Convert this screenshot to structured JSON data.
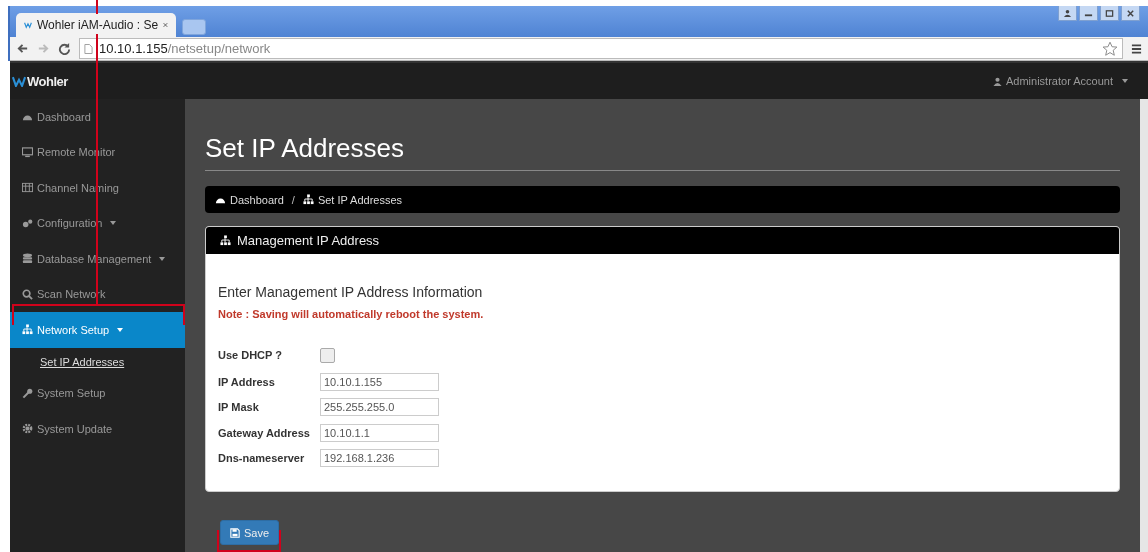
{
  "browser": {
    "tab_title": "Wohler iAM-Audio : Se",
    "url_host": "10.10.1.155",
    "url_path": "/netsetup/network"
  },
  "navbar": {
    "brand": "Wohler",
    "account": "Administrator Account"
  },
  "sidebar": {
    "items": [
      {
        "label": "Dashboard",
        "dropdown": false,
        "selected": false
      },
      {
        "label": "Remote Monitor",
        "dropdown": false,
        "selected": false
      },
      {
        "label": "Channel Naming",
        "dropdown": false,
        "selected": false
      },
      {
        "label": "Configuration",
        "dropdown": true,
        "selected": false
      },
      {
        "label": "Database Management",
        "dropdown": true,
        "selected": false
      },
      {
        "label": "Scan Network",
        "dropdown": false,
        "selected": false
      },
      {
        "label": "Network Setup",
        "dropdown": true,
        "selected": true,
        "children": [
          {
            "label": "Set IP Addresses"
          }
        ]
      },
      {
        "label": "System Setup",
        "dropdown": false,
        "selected": false
      },
      {
        "label": "System Update",
        "dropdown": false,
        "selected": false
      }
    ]
  },
  "page": {
    "title": "Set IP Addresses",
    "breadcrumb": [
      "Dashboard",
      "Set IP Addresses"
    ],
    "breadcrumb_separator": "/"
  },
  "panel": {
    "header": "Management IP Address",
    "heading": "Enter Management IP Address Information",
    "note": "Note : Saving will automatically reboot the system.",
    "dhcp": {
      "label": "Use DHCP ?",
      "checked": false
    },
    "fields": [
      {
        "label": "IP Address",
        "value": "10.10.1.155"
      },
      {
        "label": "IP Mask",
        "value": "255.255.255.0"
      },
      {
        "label": "Gateway Address",
        "value": "10.10.1.1"
      },
      {
        "label": "Dns-nameserver",
        "value": "192.168.1.236"
      }
    ]
  },
  "save_button": "Save"
}
